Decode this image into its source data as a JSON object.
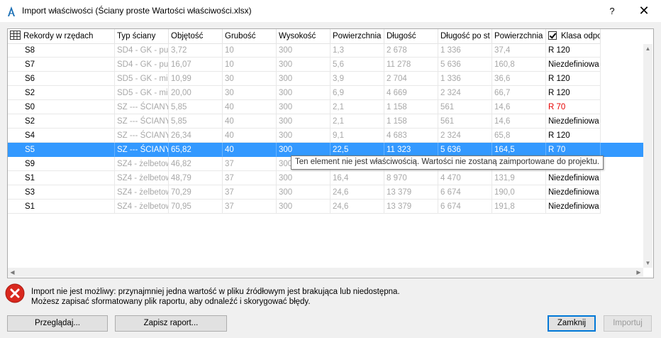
{
  "window": {
    "title": "Import właściwości (Ściany proste Wartości właściwości.xlsx)",
    "help_label": "?",
    "close_label": "✕"
  },
  "table": {
    "headers": [
      "Rekordy w rzędach",
      "Typ ściany",
      "Objętość",
      "Grubość",
      "Wysokość",
      "Powierzchnia",
      "Długość",
      "Długość po st",
      "Powierzchnia",
      "Klasa odpo"
    ],
    "rows": [
      {
        "name": "S8",
        "typ": "SD4 - GK - pus",
        "obj": "3,72",
        "grub": "10",
        "wys": "300",
        "pow1": "1,3",
        "dl": "2 678",
        "dlps": "1 336",
        "pow2": "37,4",
        "klasa": "R 120",
        "selected": false,
        "klasa_red": false
      },
      {
        "name": "S7",
        "typ": "SD4 - GK - pus",
        "obj": "16,07",
        "grub": "10",
        "wys": "300",
        "pow1": "5,6",
        "dl": "11 278",
        "dlps": "5 636",
        "pow2": "160,8",
        "klasa": "Niezdefiniowa",
        "selected": false,
        "klasa_red": false
      },
      {
        "name": "S6",
        "typ": "SD5 - GK - mię",
        "obj": "10,99",
        "grub": "30",
        "wys": "300",
        "pow1": "3,9",
        "dl": "2 704",
        "dlps": "1 336",
        "pow2": "36,6",
        "klasa": "R 120",
        "selected": false,
        "klasa_red": false
      },
      {
        "name": "S2",
        "typ": "SD5 - GK - mię",
        "obj": "20,00",
        "grub": "30",
        "wys": "300",
        "pow1": "6,9",
        "dl": "4 669",
        "dlps": "2 324",
        "pow2": "66,7",
        "klasa": "R 120",
        "selected": false,
        "klasa_red": false
      },
      {
        "name": "S0",
        "typ": "SZ --- ŚCIANY Z",
        "obj": "5,85",
        "grub": "40",
        "wys": "300",
        "pow1": "2,1",
        "dl": "1 158",
        "dlps": "561",
        "pow2": "14,6",
        "klasa": "R 70",
        "selected": false,
        "klasa_red": true
      },
      {
        "name": "S2",
        "typ": "SZ --- ŚCIANY Z",
        "obj": "5,85",
        "grub": "40",
        "wys": "300",
        "pow1": "2,1",
        "dl": "1 158",
        "dlps": "561",
        "pow2": "14,6",
        "klasa": "Niezdefiniowa",
        "selected": false,
        "klasa_red": false
      },
      {
        "name": "S4",
        "typ": "SZ --- ŚCIANY Z",
        "obj": "26,34",
        "grub": "40",
        "wys": "300",
        "pow1": "9,1",
        "dl": "4 683",
        "dlps": "2 324",
        "pow2": "65,8",
        "klasa": "R 120",
        "selected": false,
        "klasa_red": false
      },
      {
        "name": "S5",
        "typ": "SZ --- ŚCIANY Z",
        "obj": "65,82",
        "grub": "40",
        "wys": "300",
        "pow1": "22,5",
        "dl": "11 323",
        "dlps": "5 636",
        "pow2": "164,5",
        "klasa": "R 70",
        "selected": true,
        "klasa_red": false
      },
      {
        "name": "S9",
        "typ": "SZ4 - żelbetow",
        "obj": "46,82",
        "grub": "37",
        "wys": "300",
        "pow1": "",
        "dl": "",
        "dlps": "",
        "pow2": "",
        "klasa": "",
        "selected": false,
        "klasa_red": false
      },
      {
        "name": "S1",
        "typ": "SZ4 - żelbetow",
        "obj": "48,79",
        "grub": "37",
        "wys": "300",
        "pow1": "16,4",
        "dl": "8 970",
        "dlps": "4 470",
        "pow2": "131,9",
        "klasa": "Niezdefiniowa",
        "selected": false,
        "klasa_red": false
      },
      {
        "name": "S3",
        "typ": "SZ4 - żelbetow",
        "obj": "70,29",
        "grub": "37",
        "wys": "300",
        "pow1": "24,6",
        "dl": "13 379",
        "dlps": "6 674",
        "pow2": "190,0",
        "klasa": "Niezdefiniowa",
        "selected": false,
        "klasa_red": false
      },
      {
        "name": "S1",
        "typ": "SZ4 - żelbetow",
        "obj": "70,95",
        "grub": "37",
        "wys": "300",
        "pow1": "24,6",
        "dl": "13 379",
        "dlps": "6 674",
        "pow2": "191,8",
        "klasa": "Niezdefiniowa",
        "selected": false,
        "klasa_red": false
      }
    ]
  },
  "tooltip": "Ten element nie jest właściwością. Wartości nie zostaną zaimportowane do projektu.",
  "message": {
    "icon": "error-icon",
    "line1": "Import nie jest możliwy: przynajmniej jedna wartość w pliku źródłowym jest brakująca lub niedostępna.",
    "line2": "Możesz zapisać sformatowany plik raportu, aby odnaleźć i skorygować błędy."
  },
  "buttons": {
    "browse": "Przeglądaj...",
    "save_report": "Zapisz raport...",
    "close": "Zamknij",
    "import": "Importuj"
  },
  "colors": {
    "selection": "#3399ff",
    "error_red": "#e60000",
    "accent": "#0078d7"
  }
}
